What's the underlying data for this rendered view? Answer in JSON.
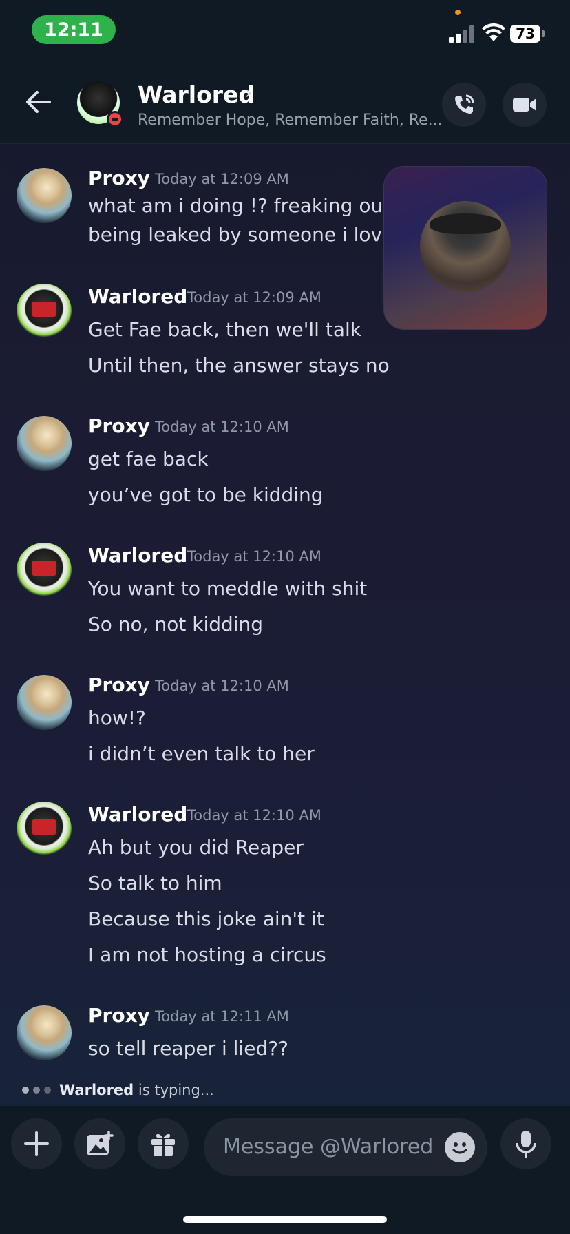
{
  "status_bar": {
    "time": "12:11",
    "battery": "73"
  },
  "header": {
    "title": "Warlored",
    "chevron": "›",
    "status_text": "Remember Hope, Remember Faith, Re...",
    "icons": [
      "back-arrow-icon",
      "phone-call-icon",
      "video-camera-icon"
    ]
  },
  "messages": [
    {
      "author": "Proxy",
      "timestamp": "Today at 12:09 AM",
      "lines": [
        "what am i doing !? freaking out b",
        "being leaked by someone i loved"
      ]
    },
    {
      "author": "Warlored",
      "timestamp": "Today at 12:09 AM",
      "lines": [
        "Get Fae back, then we'll talk",
        "Until then, the answer stays no"
      ]
    },
    {
      "author": "Proxy",
      "timestamp": "Today at 12:10 AM",
      "lines": [
        "get fae back",
        "you’ve got to be kidding"
      ]
    },
    {
      "author": "Warlored",
      "timestamp": "Today at 12:10 AM",
      "lines": [
        "You want to meddle with shit",
        "So no, not kidding"
      ]
    },
    {
      "author": "Proxy",
      "timestamp": "Today at 12:10 AM",
      "lines": [
        "how!?",
        "i didn’t even talk to her"
      ]
    },
    {
      "author": "Warlored",
      "timestamp": "Today at 12:10 AM",
      "lines": [
        "Ah but you did Reaper",
        "So talk to him",
        "Because this joke ain't it",
        "I am not hosting a circus"
      ]
    },
    {
      "author": "Proxy",
      "timestamp": "Today at 12:11 AM",
      "lines": [
        "so tell reaper i lied??"
      ]
    }
  ],
  "typing": {
    "user": "Warlored",
    "text": " is typing..."
  },
  "composer": {
    "placeholder": "Message @Warlored"
  }
}
